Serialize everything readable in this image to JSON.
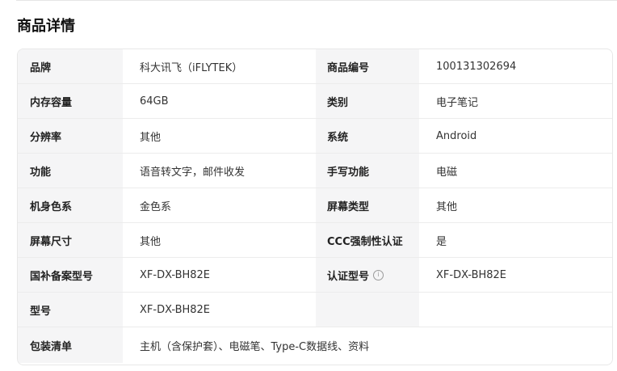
{
  "section": {
    "title": "商品详情"
  },
  "specs": {
    "rows": [
      {
        "k1": "品牌",
        "v1": "科大讯飞（iFLYTEK）",
        "k2": "商品编号",
        "v2": "100131302694"
      },
      {
        "k1": "内存容量",
        "v1": "64GB",
        "k2": "类别",
        "v2": "电子笔记"
      },
      {
        "k1": "分辨率",
        "v1": "其他",
        "k2": "系统",
        "v2": "Android"
      },
      {
        "k1": "功能",
        "v1": "语音转文字，邮件收发",
        "k2": "手写功能",
        "v2": "电磁"
      },
      {
        "k1": "机身色系",
        "v1": "金色系",
        "k2": "屏幕类型",
        "v2": "其他"
      },
      {
        "k1": "屏幕尺寸",
        "v1": "其他",
        "k2": "CCC强制性认证",
        "v2": "是"
      },
      {
        "k1": "国补备案型号",
        "v1": "XF-DX-BH82E",
        "k2": "认证型号",
        "v2": "XF-DX-BH82E",
        "k2_icon": "info-icon"
      },
      {
        "k1": "型号",
        "v1": "XF-DX-BH82E",
        "k2": "",
        "v2": ""
      }
    ],
    "last_row": {
      "k1": "包装清单",
      "v1": "主机（含保护套）、电磁笔、Type-C数据线、资料"
    }
  }
}
